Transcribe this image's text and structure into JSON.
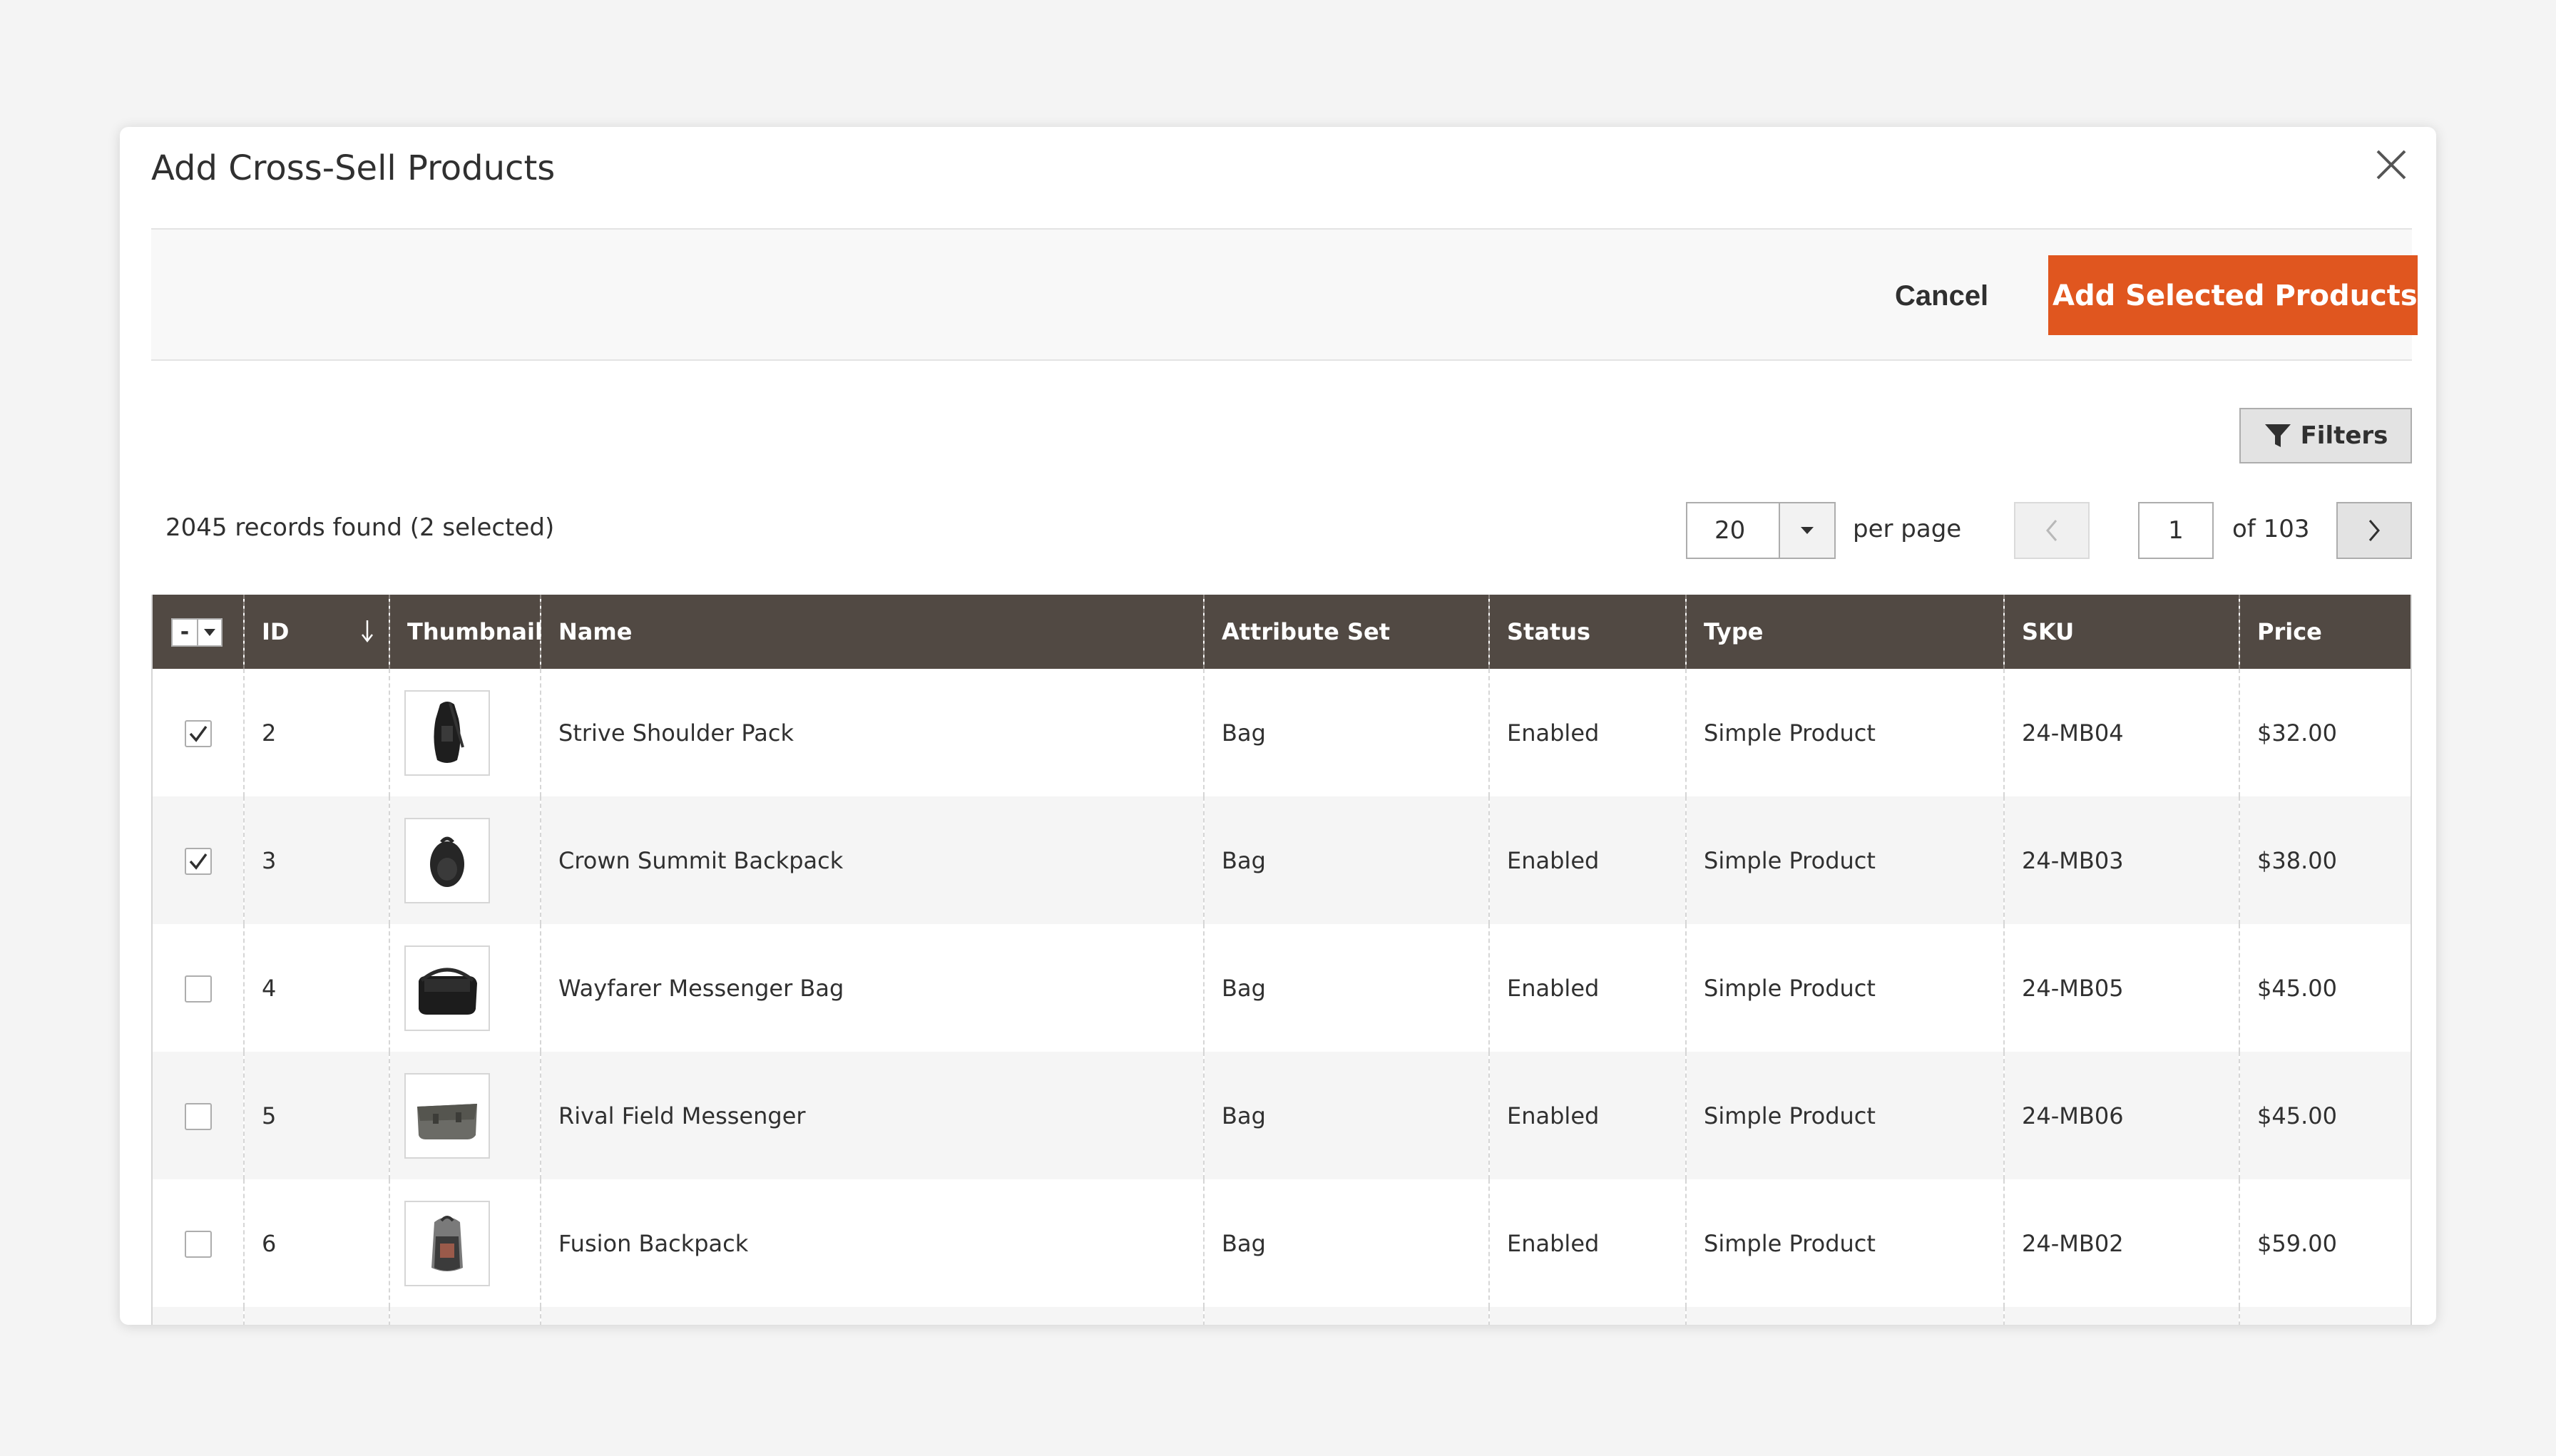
{
  "modal": {
    "title": "Add Cross-Sell Products"
  },
  "actions": {
    "cancel_label": "Cancel",
    "add_label": "Add Selected Products"
  },
  "toolbar": {
    "filters_label": "Filters",
    "records_found": "2045 records found (2 selected)",
    "per_page_value": "20",
    "per_page_label": "per page",
    "current_page": "1",
    "of_pages": "of 103"
  },
  "grid": {
    "columns": [
      "ID",
      "Thumbnail",
      "Name",
      "Attribute Set",
      "Status",
      "Type",
      "SKU",
      "Price"
    ],
    "mass_select_symbol": "-",
    "rows": [
      {
        "checked": true,
        "id": "2",
        "thumb": "shoulder-pack",
        "name": "Strive Shoulder Pack",
        "attribute_set": "Bag",
        "status": "Enabled",
        "type": "Simple Product",
        "sku": "24-MB04",
        "price": "$32.00"
      },
      {
        "checked": true,
        "id": "3",
        "thumb": "backpack",
        "name": "Crown Summit Backpack",
        "attribute_set": "Bag",
        "status": "Enabled",
        "type": "Simple Product",
        "sku": "24-MB03",
        "price": "$38.00"
      },
      {
        "checked": false,
        "id": "4",
        "thumb": "messenger-bag",
        "name": "Wayfarer Messenger Bag",
        "attribute_set": "Bag",
        "status": "Enabled",
        "type": "Simple Product",
        "sku": "24-MB05",
        "price": "$45.00"
      },
      {
        "checked": false,
        "id": "5",
        "thumb": "field-messenger",
        "name": "Rival Field Messenger",
        "attribute_set": "Bag",
        "status": "Enabled",
        "type": "Simple Product",
        "sku": "24-MB06",
        "price": "$45.00"
      },
      {
        "checked": false,
        "id": "6",
        "thumb": "fusion-backpack",
        "name": "Fusion Backpack",
        "attribute_set": "Bag",
        "status": "Enabled",
        "type": "Simple Product",
        "sku": "24-MB02",
        "price": "$59.00"
      }
    ]
  },
  "colors": {
    "accent": "#e0561f",
    "header_bg": "#514943",
    "text": "#303030"
  }
}
